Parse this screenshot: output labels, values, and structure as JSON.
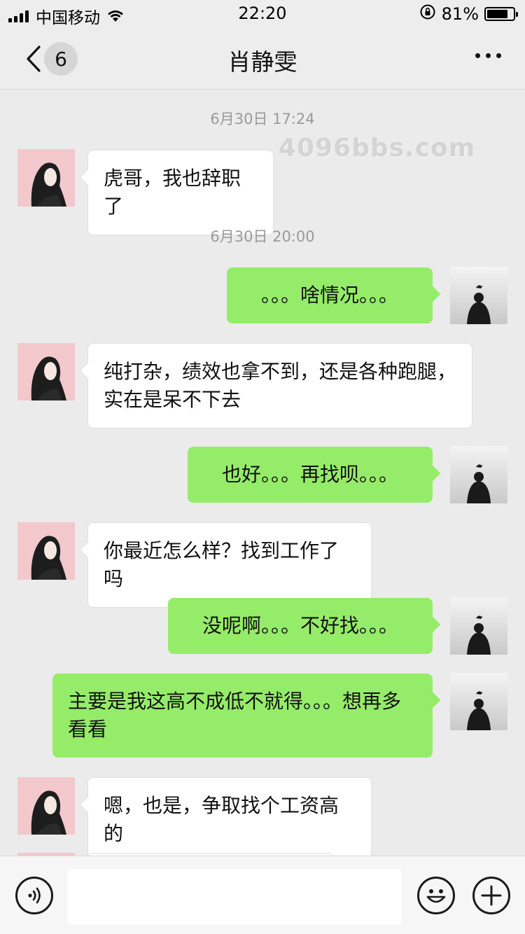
{
  "status_bar": {
    "carrier": "中国移动",
    "time": "22:20",
    "battery_percent": "81%",
    "battery_level": 0.81
  },
  "nav": {
    "unread_count": "6",
    "title": "肖静雯"
  },
  "watermark": "4096bbs.com",
  "timestamps": [
    "6月30日 17:24",
    "6月30日 20:00"
  ],
  "messages": [
    {
      "side": "left",
      "text": "虎哥，我也辞职了"
    },
    {
      "side": "right",
      "text": "。。。啥情况。。。"
    },
    {
      "side": "left",
      "text": "纯打杂，绩效也拿不到，还是各种跑腿，实在是呆不下去"
    },
    {
      "side": "right",
      "text": "也好。。。再找呗。。。"
    },
    {
      "side": "left",
      "text": "你最近怎么样？找到工作了吗"
    },
    {
      "side": "right",
      "text": "没呢啊。。。不好找。。。"
    },
    {
      "side": "right",
      "text": "主要是我这高不成低不就得。。。想再多看看"
    },
    {
      "side": "left",
      "text": "嗯，也是，争取找个工资高的"
    }
  ],
  "icons": {
    "back": "chevron-left-icon",
    "more": "more-dots-icon",
    "voice": "voice-icon",
    "emoji": "emoji-icon",
    "plus": "plus-icon"
  },
  "colors": {
    "sent_bubble": "#95ec69",
    "received_bubble": "#ffffff",
    "background": "#ebebeb"
  }
}
